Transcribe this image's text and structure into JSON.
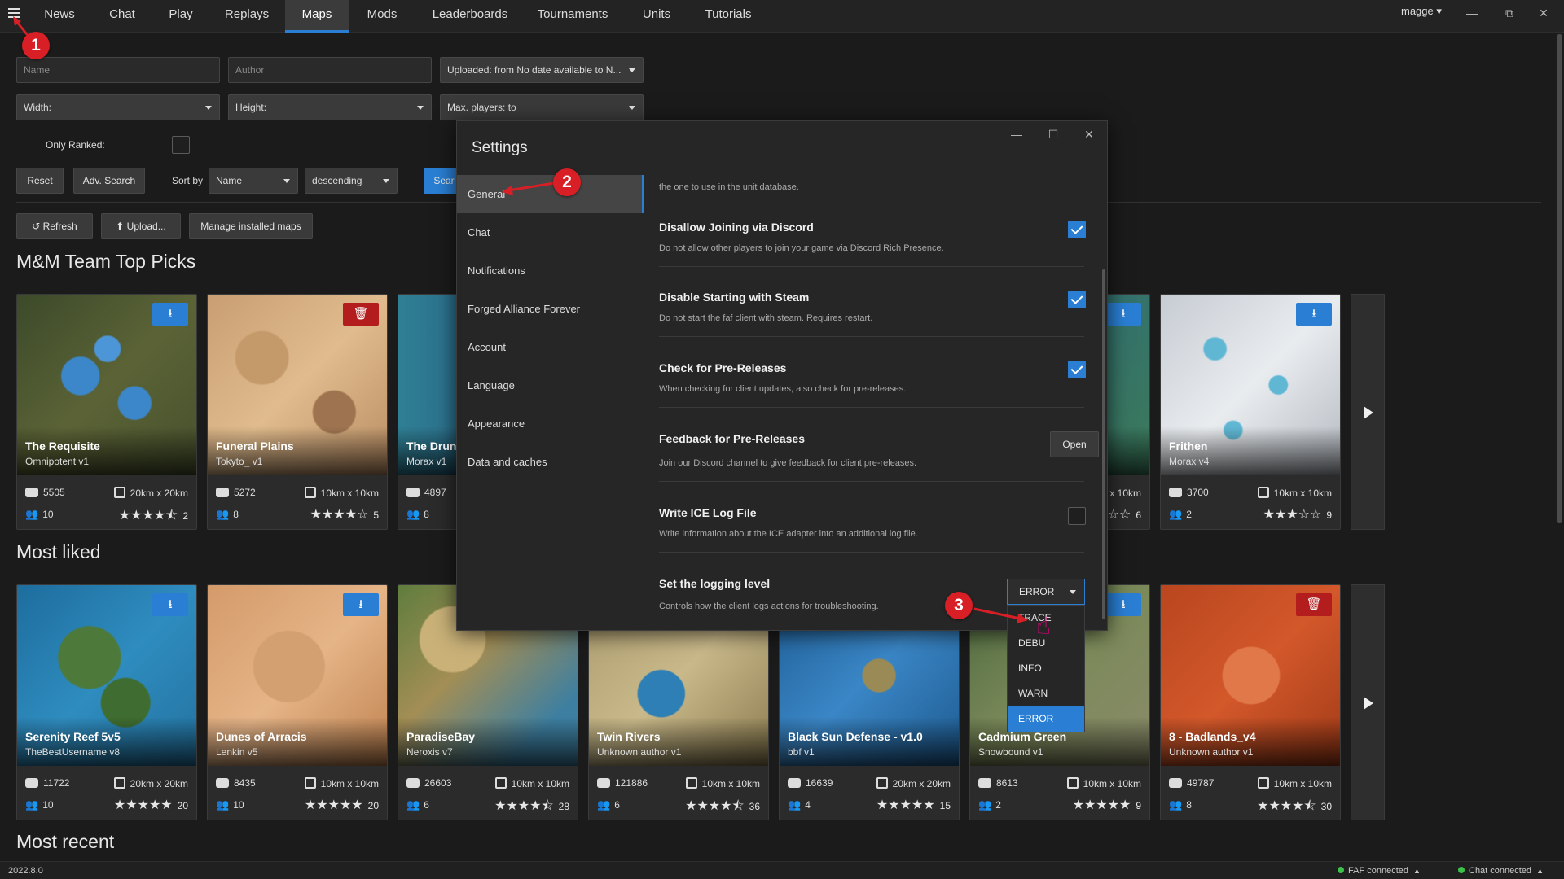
{
  "nav": {
    "tabs": [
      {
        "label": "News"
      },
      {
        "label": "Chat"
      },
      {
        "label": "Play"
      },
      {
        "label": "Replays"
      },
      {
        "label": "Maps"
      },
      {
        "label": "Mods"
      },
      {
        "label": "Leaderboards"
      },
      {
        "label": "Tournaments"
      },
      {
        "label": "Units"
      },
      {
        "label": "Tutorials"
      }
    ],
    "active_tab": "Maps",
    "user": "magge"
  },
  "filters": {
    "name_placeholder": "Name",
    "author_placeholder": "Author",
    "uploaded": "Uploaded: from No date available to N...",
    "width": "Width:",
    "height": "Height:",
    "max_players": "Max. players:  to",
    "only_ranked_label": "Only Ranked:",
    "reset_label": "Reset",
    "adv_search_label": "Adv. Search",
    "sort_by_label": "Sort by",
    "sort_field": "Name",
    "sort_order": "descending",
    "search_label": "Sear"
  },
  "actions": {
    "refresh_label": "Refresh",
    "upload_label": "Upload...",
    "manage_label": "Manage installed maps"
  },
  "sections": {
    "top_picks": "M&M Team Top Picks",
    "most_liked": "Most liked",
    "most_recent": "Most recent"
  },
  "top_picks": [
    {
      "name": "The Requisite",
      "author": "Omnipotent",
      "version": "v1",
      "plays": "5505",
      "size": "20km x 20km",
      "players": "10",
      "rating": 4.5,
      "reviews": "2",
      "action": "install"
    },
    {
      "name": "Funeral Plains",
      "author": "Tokyto_",
      "version": "v1",
      "plays": "5272",
      "size": "10km x 10km",
      "players": "8",
      "rating": 4.0,
      "reviews": "5",
      "action": "delete"
    },
    {
      "name": "The Drun",
      "author": "Morax",
      "version": "v1",
      "plays": "4897",
      "size": "",
      "players": "8",
      "rating": 0,
      "reviews": "",
      "action": ""
    },
    {
      "name": "",
      "author": "",
      "version": "",
      "plays": "",
      "size": "x 10km",
      "players": "",
      "rating": 1,
      "reviews": "6",
      "action": "install"
    },
    {
      "name": "Frithen",
      "author": "Morax",
      "version": "v4",
      "plays": "3700",
      "size": "10km x 10km",
      "players": "2",
      "rating": 3.0,
      "reviews": "9",
      "action": "install"
    }
  ],
  "most_liked": [
    {
      "name": "Serenity Reef 5v5",
      "author": "TheBestUsername",
      "version": "v8",
      "plays": "11722",
      "size": "20km x 20km",
      "players": "10",
      "rating": 5.0,
      "reviews": "20",
      "action": "install"
    },
    {
      "name": "Dunes of Arracis",
      "author": "Lenkin",
      "version": "v5",
      "plays": "8435",
      "size": "10km x 10km",
      "players": "10",
      "rating": 5.0,
      "reviews": "20",
      "action": "install"
    },
    {
      "name": "ParadiseBay",
      "author": "Neroxis",
      "version": "v7",
      "plays": "26603",
      "size": "10km x 10km",
      "players": "6",
      "rating": 4.5,
      "reviews": "28",
      "action": ""
    },
    {
      "name": "Twin Rivers",
      "author": "Unknown author",
      "version": "v1",
      "plays": "121886",
      "size": "10km x 10km",
      "players": "6",
      "rating": 4.5,
      "reviews": "36",
      "action": ""
    },
    {
      "name": "Black Sun Defense - v1.0",
      "author": "bbf",
      "version": "v1",
      "plays": "16639",
      "size": "20km x 20km",
      "players": "4",
      "rating": 5.0,
      "reviews": "15",
      "action": ""
    },
    {
      "name": "Cadmium Green",
      "author": "Snowbound",
      "version": "v1",
      "plays": "8613",
      "size": "10km x 10km",
      "players": "2",
      "rating": 5.0,
      "reviews": "9",
      "action": "install"
    },
    {
      "name": "8 - Badlands_v4",
      "author": "Unknown author",
      "version": "v1",
      "plays": "49787",
      "size": "10km x 10km",
      "players": "8",
      "rating": 4.5,
      "reviews": "30",
      "action": "delete"
    }
  ],
  "settings": {
    "title": "Settings",
    "nav": [
      {
        "label": "General"
      },
      {
        "label": "Chat"
      },
      {
        "label": "Notifications"
      },
      {
        "label": "Forged Alliance Forever"
      },
      {
        "label": "Account"
      },
      {
        "label": "Language"
      },
      {
        "label": "Appearance"
      },
      {
        "label": "Data and caches"
      }
    ],
    "active_nav": "General",
    "intro_text": "the one to use in the unit database.",
    "rows": [
      {
        "title": "Disallow Joining via Discord",
        "desc": "Do not allow other players to join your game via Discord Rich Presence.",
        "checked": true
      },
      {
        "title": "Disable Starting with Steam",
        "desc": "Do not start the faf client with steam. Requires restart.",
        "checked": true
      },
      {
        "title": "Check for Pre-Releases",
        "desc": "When checking for client updates, also check for pre-releases.",
        "checked": true
      },
      {
        "title": "Feedback for Pre-Releases",
        "desc": "Join our Discord channel to give feedback for client pre-releases.",
        "button": "Open"
      },
      {
        "title": "Write ICE Log File",
        "desc": "Write information about the ICE adapter into an additional log file.",
        "checked": false
      },
      {
        "title": "Set the logging level",
        "desc": "Controls how the client logs actions for troubleshooting."
      }
    ],
    "log_level": {
      "selected": "ERROR",
      "options": [
        "TRACE",
        "DEBU",
        "INFO",
        "WARN",
        "ERROR"
      ]
    }
  },
  "annotations": [
    "1",
    "2",
    "3"
  ],
  "status": {
    "version": "2022.8.0",
    "faf": "FAF connected",
    "chat": "Chat connected"
  },
  "colors": {
    "accent": "#2a7fd4",
    "delete": "#b31d1d",
    "annotation": "#d91f26",
    "connected": "#3bc24a"
  }
}
